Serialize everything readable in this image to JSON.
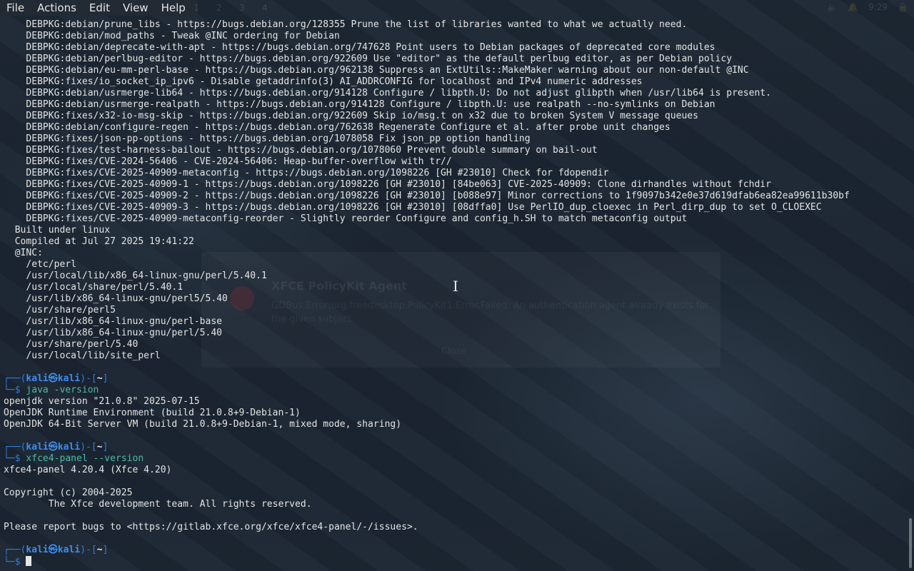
{
  "menu": [
    "File",
    "Actions",
    "Edit",
    "View",
    "Help"
  ],
  "workspaces": [
    "1",
    "2",
    "3",
    "4"
  ],
  "tray": {
    "clock": "9:29"
  },
  "notification": {
    "title": "XFCE PolicyKit Agent",
    "body": "GDBus.Error:org.freedesktop.PolicyKit1.Error.Failed: An authentication agent already exists for the given subject",
    "close_label": "Close"
  },
  "debpkg_lines": [
    "DEBPKG:debian/prune_libs - https://bugs.debian.org/128355 Prune the list of libraries wanted to what we actually need.",
    "DEBPKG:debian/mod_paths - Tweak @INC ordering for Debian",
    "DEBPKG:debian/deprecate-with-apt - https://bugs.debian.org/747628 Point users to Debian packages of deprecated core modules",
    "DEBPKG:debian/perlbug-editor - https://bugs.debian.org/922609 Use \"editor\" as the default perlbug editor, as per Debian policy",
    "DEBPKG:debian/eu-mm-perl-base - https://bugs.debian.org/962138 Suppress an ExtUtils::MakeMaker warning about our non-default @INC",
    "DEBPKG:fixes/io_socket_ip_ipv6 - Disable getaddrinfo(3) AI_ADDRCONFIG for localhost and IPv4 numeric addresses",
    "DEBPKG:debian/usrmerge-lib64 - https://bugs.debian.org/914128 Configure / libpth.U: Do not adjust glibpth when /usr/lib64 is present.",
    "DEBPKG:debian/usrmerge-realpath - https://bugs.debian.org/914128 Configure / libpth.U: use realpath --no-symlinks on Debian",
    "DEBPKG:fixes/x32-io-msg-skip - https://bugs.debian.org/922609 Skip io/msg.t on x32 due to broken System V message queues",
    "DEBPKG:debian/configure-regen - https://bugs.debian.org/762638 Regenerate Configure et al. after probe unit changes",
    "DEBPKG:fixes/json-pp-options - https://bugs.debian.org/1078058 Fix json_pp option handling",
    "DEBPKG:fixes/test-harness-bailout - https://bugs.debian.org/1078060 Prevent double summary on bail-out",
    "DEBPKG:fixes/CVE-2024-56406 - CVE-2024-56406: Heap-buffer-overflow with tr//",
    "DEBPKG:fixes/CVE-2025-40909-metaconfig - https://bugs.debian.org/1098226 [GH #23010] Check for fdopendir",
    "DEBPKG:fixes/CVE-2025-40909-1 - https://bugs.debian.org/1098226 [GH #23010] [84be063] CVE-2025-40909: Clone dirhandles without fchdir",
    "DEBPKG:fixes/CVE-2025-40909-2 - https://bugs.debian.org/1098226 [GH #23010] [b088e97] Minor corrections to 1f9097b342e0e37d619dfab6ea82ea99611b30bf",
    "DEBPKG:fixes/CVE-2025-40909-3 - https://bugs.debian.org/1098226 [GH #23010] [08dffa0] Use PerlIO_dup_cloexec in Perl_dirp_dup to set O_CLOEXEC",
    "DEBPKG:fixes/CVE-2025-40909-metaconfig-reorder - Slightly reorder Configure and config_h.SH to match metaconfig output"
  ],
  "build_lines": [
    "Built under linux",
    "Compiled at Jul 27 2025 19:41:22",
    "@INC:"
  ],
  "inc_paths": [
    "/etc/perl",
    "/usr/local/lib/x86_64-linux-gnu/perl/5.40.1",
    "/usr/local/share/perl/5.40.1",
    "/usr/lib/x86_64-linux-gnu/perl5/5.40",
    "/usr/share/perl5",
    "/usr/lib/x86_64-linux-gnu/perl-base",
    "/usr/lib/x86_64-linux-gnu/perl/5.40",
    "/usr/share/perl/5.40",
    "/usr/local/lib/site_perl"
  ],
  "prompt": {
    "user": "kali",
    "at": "㉿",
    "host": "kali",
    "dir": "~",
    "open": "┌──(",
    "close": ")-[",
    "end": "]",
    "second": "└─$ "
  },
  "cmd1": "java -version",
  "java_output": [
    "openjdk version \"21.0.8\" 2025-07-15",
    "OpenJDK Runtime Environment (build 21.0.8+9-Debian-1)",
    "OpenJDK 64-Bit Server VM (build 21.0.8+9-Debian-1, mixed mode, sharing)"
  ],
  "cmd2": "xfce4-panel --version",
  "xfce_output": [
    "xfce4-panel 4.20.4 (Xfce 4.20)",
    "",
    "Copyright (c) 2004-2025",
    "        The Xfce development team. All rights reserved.",
    "",
    "Please report bugs to <https://gitlab.xfce.org/xfce/xfce4-panel/-/issues>."
  ]
}
